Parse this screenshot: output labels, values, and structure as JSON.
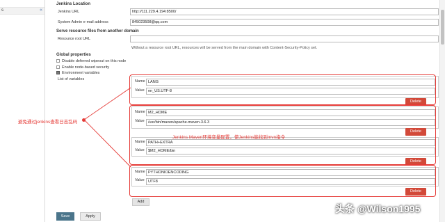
{
  "sidebar": {
    "item_label": "s",
    "collapse_label": "«"
  },
  "jenkins_location": {
    "title": "Jenkins Location",
    "url_label": "Jenkins URL",
    "url_value": "http://111.229.4.194:8500/",
    "email_label": "System Admin e-mail address",
    "email_value": "845023508@qq.com"
  },
  "serve_resource": {
    "title": "Serve resource files from another domain",
    "root_label": "Resource root URL",
    "root_value": "",
    "hint": "Without a resource root URL, resources will be served from the main domain with Content-Security-Policy set."
  },
  "global_properties": {
    "title": "Global properties",
    "options": [
      {
        "label": "Disable deferred wipeout on this node",
        "checked": false
      },
      {
        "label": "Enable node-based security",
        "checked": false
      },
      {
        "label": "Environment variables",
        "checked": true
      }
    ],
    "list_label": "List of variables"
  },
  "env_vars": {
    "name_label": "Name",
    "value_label": "Value",
    "delete_label": "Delete",
    "items": [
      {
        "name": "LANG",
        "value": "en_US.UTF-8"
      },
      {
        "name": "M2_HOME",
        "value": "/usr/bin/maven/apache-maven-3.6.3"
      },
      {
        "name": "PATH+EXTRA",
        "value": "$M2_HOME/bin"
      },
      {
        "name": "PYTHONIOENCODING",
        "value": "UTF8"
      }
    ]
  },
  "buttons": {
    "add": "Add",
    "save": "Save",
    "apply": "Apply"
  },
  "annotations": {
    "left_note": "避免通过jenkins查看日志乱码",
    "maven_note": "Jenkins Maven环境变量配置，使Jenkins能找到mvn指令",
    "color": "#e53935"
  },
  "watermark": "头条 @Wilson1995"
}
